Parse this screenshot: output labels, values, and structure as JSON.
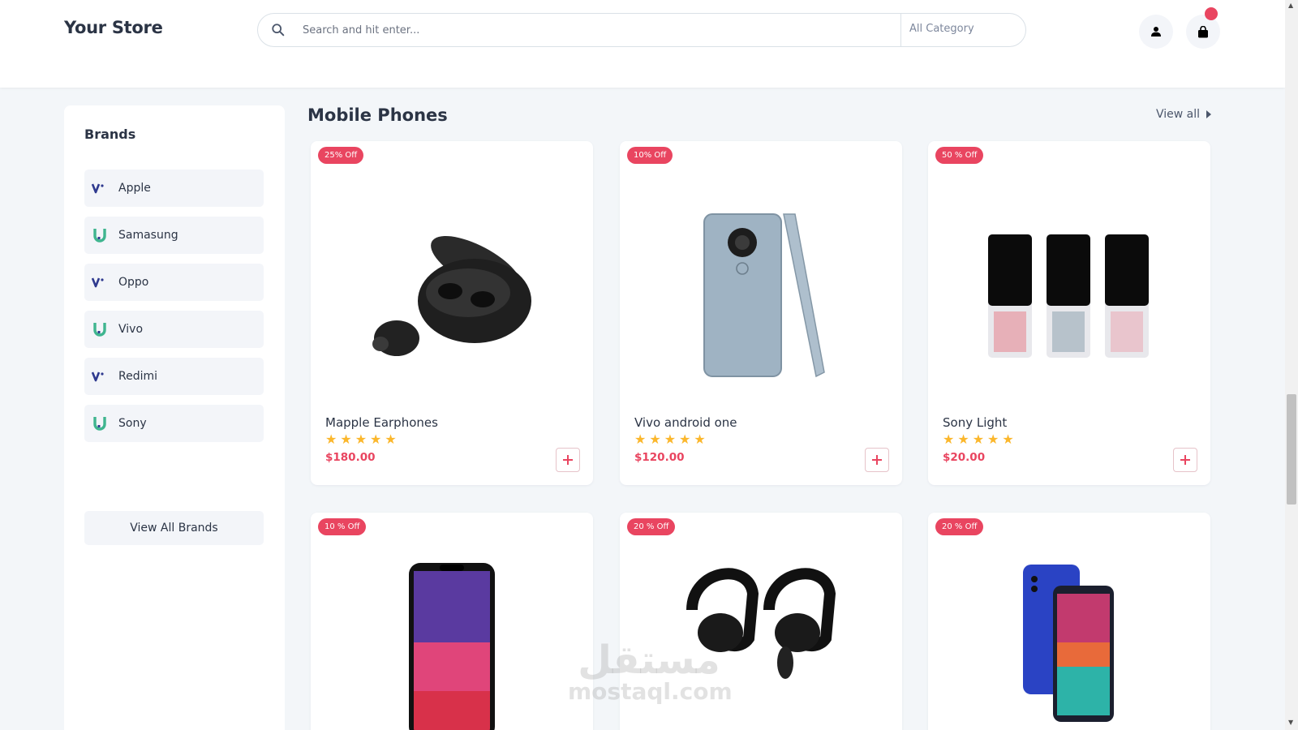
{
  "header": {
    "logo": "Your Store",
    "search_placeholder": "Search and hit enter...",
    "category_select": "All Category"
  },
  "sidebar": {
    "title": "Brands",
    "brands": [
      {
        "label": "Apple",
        "logo": "v-logo-icon"
      },
      {
        "label": "Samasung",
        "logo": "u-logo-icon"
      },
      {
        "label": "Oppo",
        "logo": "v-logo-icon"
      },
      {
        "label": "Vivo",
        "logo": "u-logo-icon"
      },
      {
        "label": "Redimi",
        "logo": "v-logo-icon"
      },
      {
        "label": "Sony",
        "logo": "u-logo-icon"
      }
    ],
    "view_all_label": "View All Brands"
  },
  "section": {
    "title": "Mobile Phones",
    "view_all_label": "View all"
  },
  "products": [
    {
      "badge": "25% Off",
      "name": "Mapple Earphones",
      "price": "$180.00",
      "rating": 5,
      "image": "earbuds-case-image"
    },
    {
      "badge": "10% Off",
      "name": "Vivo android one",
      "price": "$120.00",
      "rating": 5,
      "image": "silver-smartphone-image"
    },
    {
      "badge": "50 % Off",
      "name": "Sony Light",
      "price": "$20.00",
      "rating": 5,
      "image": "feature-phones-image"
    },
    {
      "badge": "10 % Off",
      "name": "",
      "price": "",
      "image": "iphone-image"
    },
    {
      "badge": "20 % Off",
      "name": "",
      "price": "",
      "image": "wireless-earhooks-image"
    },
    {
      "badge": "20 % Off",
      "name": "",
      "price": "",
      "image": "blue-smartphone-image"
    }
  ],
  "watermark": {
    "arabic": "مستقل",
    "latin": "mostaql.com"
  },
  "colors": {
    "accent": "#e94560",
    "star": "#fbb72c",
    "text": "#2b3445",
    "v_logo": "#2f3a8f",
    "u_logo": "#3fb58f"
  }
}
